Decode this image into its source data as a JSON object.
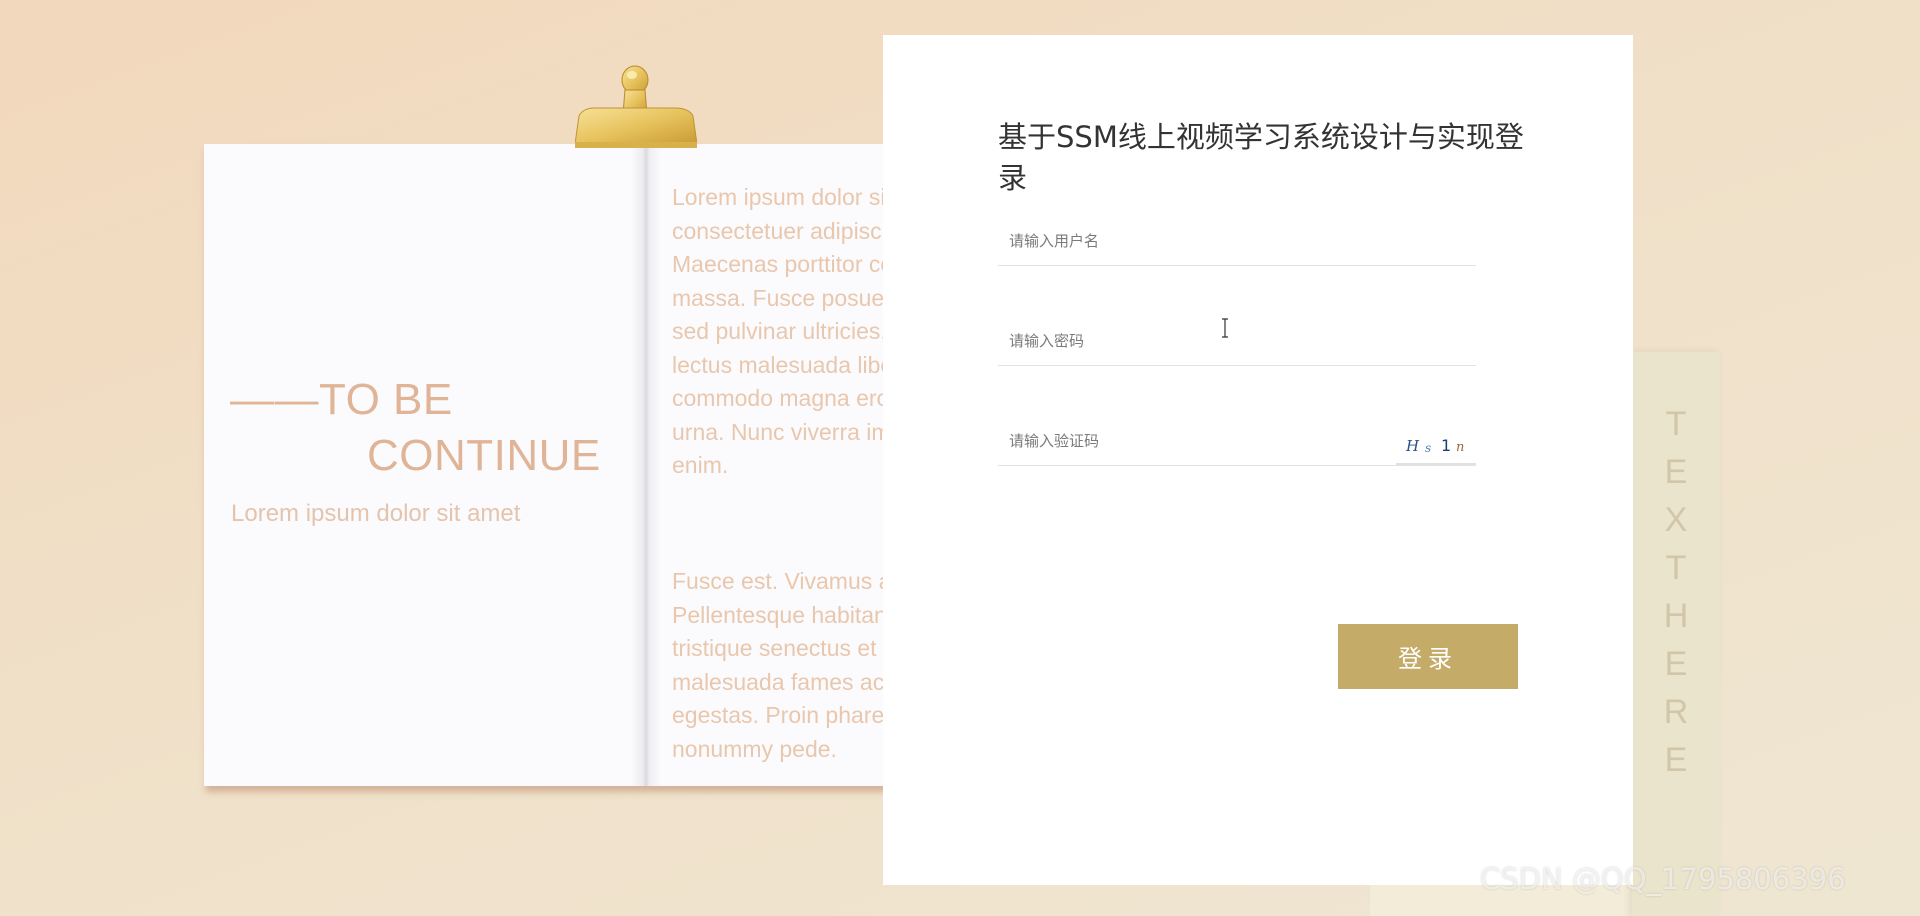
{
  "background_paper": {
    "headline_line1": "——TO BE",
    "headline_line2": "CONTINUE",
    "subtitle": "Lorem ipsum dolor sit amet",
    "body_lines_1": [
      "Lorem ipsum dolor sit amet,",
      "consectetuer adipiscing elit.",
      "Maecenas porttitor congue",
      "massa. Fusce posuere, magna",
      "sed pulvinar ultricies, purus",
      "lectus malesuada libero, sit",
      "commodo magna eros quis",
      "urna. Nunc viverra imperdiet",
      "enim."
    ],
    "body_lines_2": [
      "Fusce est. Vivamus a tellus.",
      "Pellentesque habitant morbi",
      "tristique senectus et netus et",
      "malesuada fames ac turpis",
      "egestas. Proin pharetra",
      "nonummy pede."
    ]
  },
  "side_column": {
    "letters": [
      "T",
      "E",
      "X",
      "T",
      "H",
      "E",
      "R",
      "E"
    ]
  },
  "login": {
    "title": "基于SSM线上视频学习系统设计与实现登录",
    "username_placeholder": "请输入用户名",
    "password_placeholder": "请输入密码",
    "captcha_placeholder": "请输入验证码",
    "captcha_text": "Hs1n",
    "submit_label": "登录"
  },
  "watermark": "CSDN @QQ_1795806396",
  "colors": {
    "accent_button": "#c4ac68",
    "paper_text": "#e0b597",
    "card_background": "#ffffff"
  }
}
